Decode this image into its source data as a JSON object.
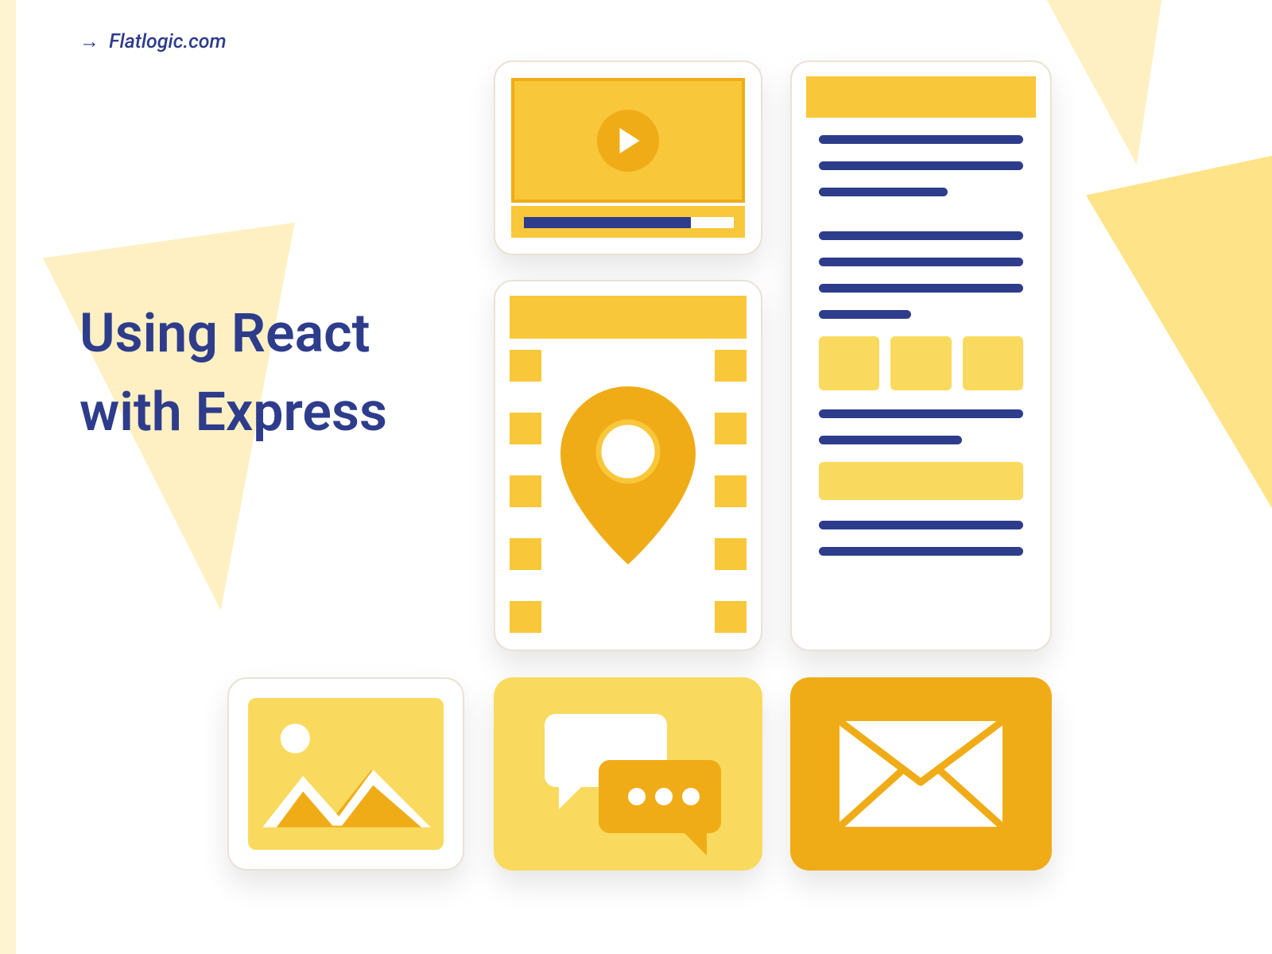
{
  "brand": {
    "arrow": "→",
    "label": "Flatlogic.com"
  },
  "headline": {
    "line1": "Using React",
    "line2": "with Express"
  },
  "colors": {
    "navy": "#2E3C8C",
    "yellow": "#F8C73A",
    "amber": "#F0AC17",
    "lightyellow": "#FADA5E",
    "cream": "#FEF0C2"
  },
  "cards": {
    "video": "video-player-card",
    "map": "map-location-card",
    "document": "text-document-card",
    "image": "image-placeholder-card",
    "chat": "chat-bubbles-card",
    "mail": "envelope-mail-card"
  }
}
